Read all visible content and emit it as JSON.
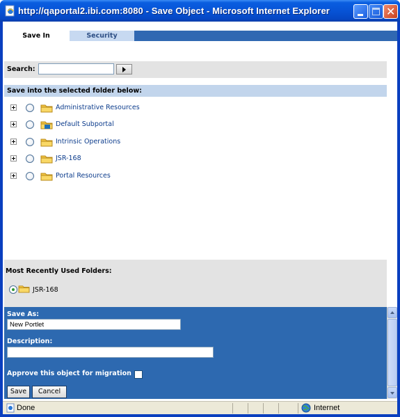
{
  "window": {
    "title": "http://qaportal2.ibi.com:8080 - Save Object - Microsoft Internet Explorer"
  },
  "tabs": [
    {
      "label": "Save In",
      "active": true
    },
    {
      "label": "Security",
      "active": false
    }
  ],
  "search": {
    "label": "Search:",
    "value": "",
    "button_icon": "arrow-right-icon"
  },
  "folders_header": "Save into the selected folder below:",
  "folders": [
    {
      "label": "Administrative Resources",
      "icon": "folder-icon"
    },
    {
      "label": "Default Subportal",
      "icon": "portal-folder-icon"
    },
    {
      "label": "Intrinsic Operations",
      "icon": "folder-icon"
    },
    {
      "label": "JSR-168",
      "icon": "folder-icon"
    },
    {
      "label": "Portal Resources",
      "icon": "folder-icon"
    }
  ],
  "mru": {
    "title": "Most Recently Used Folders:",
    "items": [
      {
        "label": "JSR-168",
        "selected": true
      }
    ]
  },
  "form": {
    "save_as_label": "Save As:",
    "save_as_value": "New Portlet",
    "description_label": "Description:",
    "description_value": "",
    "approve_label": "Approve this object for migration",
    "approve_checked": false,
    "save_button": "Save",
    "cancel_button": "Cancel"
  },
  "status": {
    "text": "Done",
    "zone": "Internet"
  },
  "colors": {
    "title_bar": "#0753d6",
    "tab_bar": "#3068b2",
    "form_panel": "#2d69b0",
    "folder_header": "#c2d5ec",
    "link_text": "#0c3c8c"
  }
}
